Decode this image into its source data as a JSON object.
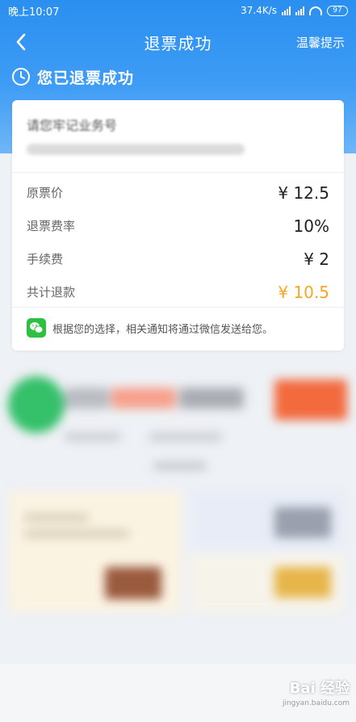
{
  "status_bar": {
    "time": "晚上10:07",
    "network_speed": "37.4K/s",
    "battery": "97"
  },
  "nav": {
    "title": "退票成功",
    "right_link": "温馨提示"
  },
  "success": {
    "message": "您已退票成功"
  },
  "card": {
    "order_title": "请您牢记业务号",
    "rows": [
      {
        "label": "原票价",
        "value": "¥ 12.5",
        "highlight": false
      },
      {
        "label": "退票费率",
        "value": "10%",
        "highlight": false
      },
      {
        "label": "手续费",
        "value": "¥ 2",
        "highlight": false
      },
      {
        "label": "共计退款",
        "value": "¥ 10.5",
        "highlight": true
      }
    ],
    "notice": "根据您的选择，相关通知将通过微信发送给您。"
  },
  "watermark": {
    "brand": "Bai 经验",
    "url": "jingyan.baidu.com"
  },
  "colors": {
    "header_blue": "#2a8ff0",
    "refund_orange": "#f5a623",
    "wechat_green": "#2ec140"
  }
}
